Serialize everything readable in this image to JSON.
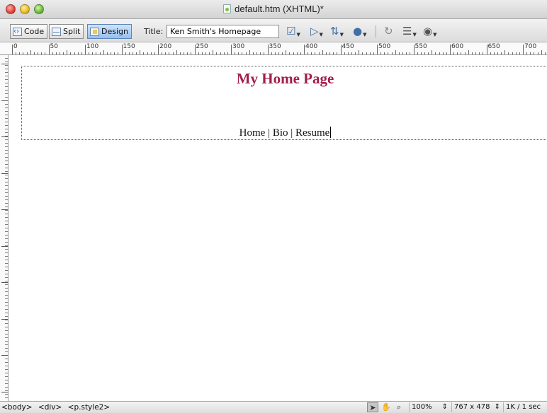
{
  "window": {
    "title": "default.htm (XHTML)*"
  },
  "toolbar": {
    "code_label": "Code",
    "split_label": "Split",
    "design_label": "Design",
    "title_label": "Title:",
    "title_value": "Ken Smith's Homepage",
    "icons": [
      "validate-markup-icon",
      "file-management-icon",
      "browser-preview-icon",
      "refresh-icon",
      "view-options-icon",
      "visual-aids-icon",
      "debug-icon"
    ]
  },
  "ruler": {
    "labels": [
      "0",
      "50",
      "100",
      "150",
      "200",
      "250",
      "300",
      "350",
      "400",
      "450",
      "500",
      "550",
      "600",
      "650",
      "700"
    ]
  },
  "page": {
    "heading": "My Home Page",
    "nav": "Home | Bio | Resume"
  },
  "statusbar": {
    "tags": [
      "<body>",
      "<div>",
      "<p.style2>"
    ],
    "zoom": "100%",
    "window_size": "767 x 478",
    "download_info": "1K / 1 sec"
  },
  "colors": {
    "heading": "#a31d4b",
    "active_view": "#95bfee"
  }
}
